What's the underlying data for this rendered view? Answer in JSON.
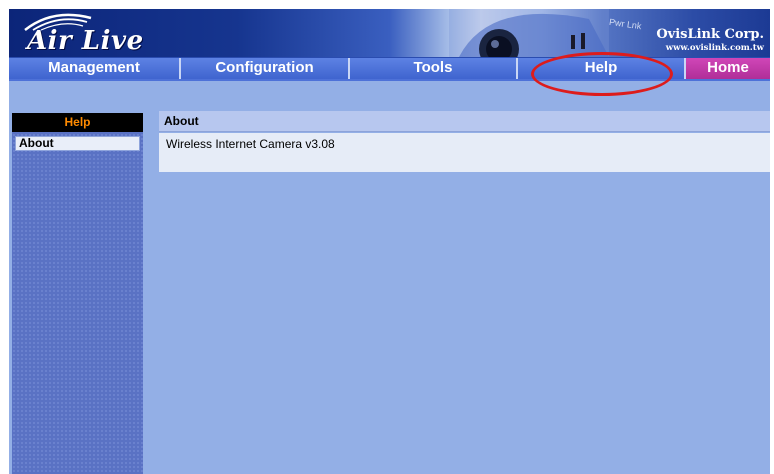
{
  "banner": {
    "logo_text": "Air Live",
    "company_name": "OvisLink Corp.",
    "company_url": "www.ovislink.com.tw",
    "pwr_lnk_label": "Pwr Lnk"
  },
  "nav": {
    "items": [
      {
        "label": "Management"
      },
      {
        "label": "Configuration"
      },
      {
        "label": "Tools"
      },
      {
        "label": "Help"
      },
      {
        "label": "Home"
      }
    ],
    "active": "Help"
  },
  "sidebar": {
    "header": "Help",
    "items": [
      {
        "label": "About"
      }
    ]
  },
  "content": {
    "section_title": "About",
    "body_text": "Wireless Internet Camera v3.08"
  },
  "colors": {
    "page_bg": "#93afe6",
    "nav_bg": "#4d71d8",
    "home_tab": "#c43aa8",
    "sidebar_header_text": "#ff8a00",
    "highlight_ring": "#dd1c1c"
  }
}
